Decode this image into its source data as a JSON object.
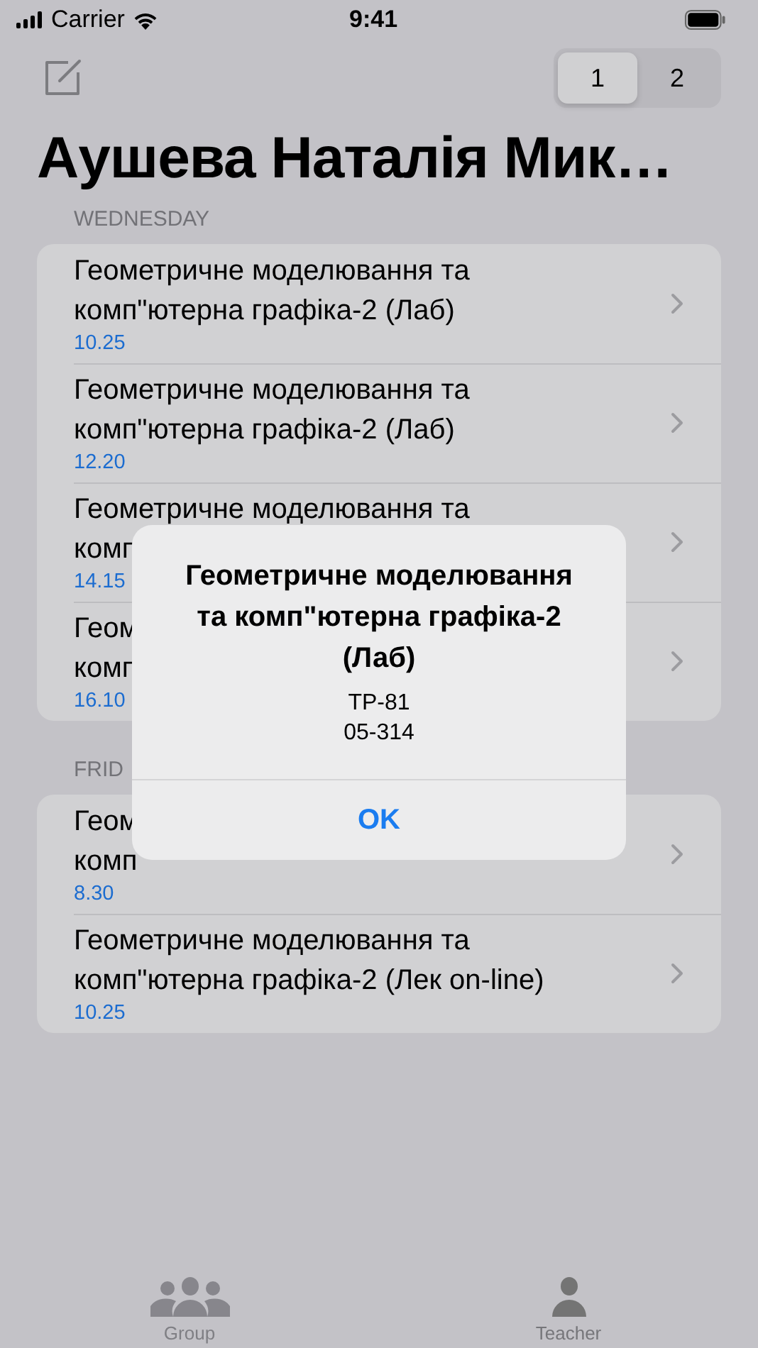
{
  "status_bar": {
    "carrier": "Carrier",
    "time": "9:41"
  },
  "segments": [
    {
      "label": "1",
      "selected": true
    },
    {
      "label": "2",
      "selected": false
    }
  ],
  "title": "Аушева Наталія Мик…",
  "sections": [
    {
      "header": "WEDNESDAY",
      "rows": [
        {
          "lines": [
            "Геометричне моделювання та",
            "комп\"ютерна графіка-2 (Лаб)"
          ],
          "time": "10.25"
        },
        {
          "lines": [
            "Геометричне моделювання та",
            "комп\"ютерна графіка-2 (Лаб)"
          ],
          "time": "12.20"
        },
        {
          "lines": [
            "Геометричне моделювання та",
            "комп"
          ],
          "time": "14.15"
        },
        {
          "lines": [
            "Геом",
            "комп"
          ],
          "time": "16.10"
        }
      ]
    },
    {
      "header": "FRID",
      "rows": [
        {
          "lines": [
            "Геом",
            "комп"
          ],
          "time": "8.30"
        },
        {
          "lines": [
            "Геометричне моделювання та",
            "комп\"ютерна графіка-2 (Лек on-line)"
          ],
          "time": "10.25"
        }
      ]
    }
  ],
  "alert": {
    "title": "Геометричне моделювання та комп\"ютерна графіка-2 (Лаб)",
    "lines": [
      "ТР-81",
      "05-314"
    ],
    "button": "OK"
  },
  "tab_bar": [
    {
      "label": "Group",
      "kind": "group",
      "selected": false
    },
    {
      "label": "Teacher",
      "kind": "person",
      "selected": true
    }
  ]
}
